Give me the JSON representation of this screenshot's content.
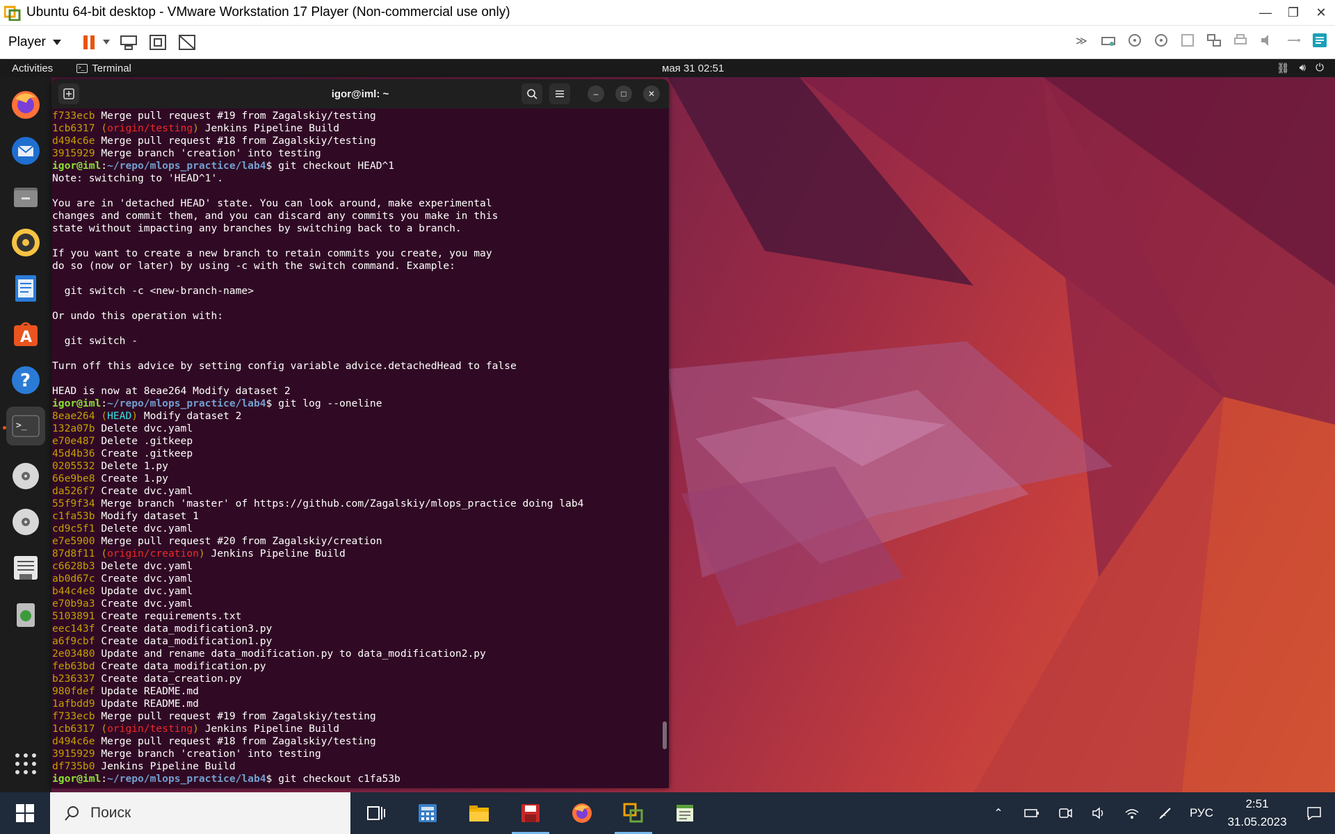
{
  "vmware": {
    "window_title": "Ubuntu 64-bit desktop - VMware Workstation 17 Player (Non-commercial use only)",
    "player_menu": "Player",
    "toolbar_icons": [
      "pause-icon",
      "send-ctrl-alt-del-icon",
      "full-screen-icon",
      "unity-icon"
    ],
    "device_icons": [
      "more-devices-icon",
      "hard-disk-icon",
      "cd-dvd-icon",
      "cd-dvd-icon",
      "floppy-icon",
      "network-adapter-icon",
      "printer-icon",
      "sound-card-icon",
      "usb-icon",
      "message-log-icon"
    ]
  },
  "ubuntu_bar": {
    "activities": "Activities",
    "app_name": "Terminal",
    "clock": "мая 31  02:51"
  },
  "dock": {
    "apps": [
      "firefox",
      "thunderbird",
      "files",
      "rhythmbox",
      "libreoffice-writer",
      "ubuntu-software",
      "help",
      "terminal",
      "dvd-drive",
      "dvd-drive",
      "text-document",
      "trash",
      "show-apps"
    ]
  },
  "terminal": {
    "title": "igor@iml: ~",
    "prompt_user": "igor@iml",
    "prompt_path": "~/repo/mlops_practice/lab4",
    "lines": [
      {
        "t": "log",
        "hash": "f733ecb",
        "msg": "Merge pull request #19 from Zagalskiy/testing"
      },
      {
        "t": "log",
        "hash": "1cb6317",
        "ref": "origin/testing",
        "msg": "Jenkins Pipeline Build"
      },
      {
        "t": "log",
        "hash": "d494c6e",
        "msg": "Merge pull request #18 from Zagalskiy/testing"
      },
      {
        "t": "log",
        "hash": "3915929",
        "msg": "Merge branch 'creation' into testing"
      },
      {
        "t": "prompt",
        "cmd": "git checkout HEAD^1"
      },
      {
        "t": "text",
        "msg": "Note: switching to 'HEAD^1'."
      },
      {
        "t": "text",
        "msg": ""
      },
      {
        "t": "text",
        "msg": "You are in 'detached HEAD' state. You can look around, make experimental"
      },
      {
        "t": "text",
        "msg": "changes and commit them, and you can discard any commits you make in this"
      },
      {
        "t": "text",
        "msg": "state without impacting any branches by switching back to a branch."
      },
      {
        "t": "text",
        "msg": ""
      },
      {
        "t": "text",
        "msg": "If you want to create a new branch to retain commits you create, you may"
      },
      {
        "t": "text",
        "msg": "do so (now or later) by using -c with the switch command. Example:"
      },
      {
        "t": "text",
        "msg": ""
      },
      {
        "t": "text",
        "msg": "  git switch -c <new-branch-name>"
      },
      {
        "t": "text",
        "msg": ""
      },
      {
        "t": "text",
        "msg": "Or undo this operation with:"
      },
      {
        "t": "text",
        "msg": ""
      },
      {
        "t": "text",
        "msg": "  git switch -"
      },
      {
        "t": "text",
        "msg": ""
      },
      {
        "t": "text",
        "msg": "Turn off this advice by setting config variable advice.detachedHead to false"
      },
      {
        "t": "text",
        "msg": ""
      },
      {
        "t": "text",
        "msg": "HEAD is now at 8eae264 Modify dataset 2"
      },
      {
        "t": "prompt",
        "cmd": "git log --oneline"
      },
      {
        "t": "log",
        "hash": "8eae264",
        "ref": "HEAD",
        "refType": "head",
        "msg": "Modify dataset 2"
      },
      {
        "t": "log",
        "hash": "132a07b",
        "msg": "Delete dvc.yaml"
      },
      {
        "t": "log",
        "hash": "e70e487",
        "msg": "Delete .gitkeep"
      },
      {
        "t": "log",
        "hash": "45d4b36",
        "msg": "Create .gitkeep"
      },
      {
        "t": "log",
        "hash": "0205532",
        "msg": "Delete 1.py"
      },
      {
        "t": "log",
        "hash": "66e9be8",
        "msg": "Create 1.py"
      },
      {
        "t": "log",
        "hash": "da526f7",
        "msg": "Create dvc.yaml"
      },
      {
        "t": "log",
        "hash": "55f9f34",
        "msg": "Merge branch 'master' of https://github.com/Zagalskiy/mlops_practice doing lab4"
      },
      {
        "t": "log",
        "hash": "c1fa53b",
        "msg": "Modify dataset 1"
      },
      {
        "t": "log",
        "hash": "cd9c5f1",
        "msg": "Delete dvc.yaml"
      },
      {
        "t": "log",
        "hash": "e7e5900",
        "msg": "Merge pull request #20 from Zagalskiy/creation"
      },
      {
        "t": "log",
        "hash": "87d8f11",
        "ref": "origin/creation",
        "msg": "Jenkins Pipeline Build"
      },
      {
        "t": "log",
        "hash": "c6628b3",
        "msg": "Delete dvc.yaml"
      },
      {
        "t": "log",
        "hash": "ab0d67c",
        "msg": "Create dvc.yaml"
      },
      {
        "t": "log",
        "hash": "b44c4e8",
        "msg": "Update dvc.yaml"
      },
      {
        "t": "log",
        "hash": "e70b9a3",
        "msg": "Create dvc.yaml"
      },
      {
        "t": "log",
        "hash": "5103891",
        "msg": "Create requirements.txt"
      },
      {
        "t": "log",
        "hash": "eec143f",
        "msg": "Create data_modification3.py"
      },
      {
        "t": "log",
        "hash": "a6f9cbf",
        "msg": "Create data_modification1.py"
      },
      {
        "t": "log",
        "hash": "2e03480",
        "msg": "Update and rename data_modification.py to data_modification2.py"
      },
      {
        "t": "log",
        "hash": "feb63bd",
        "msg": "Create data_modification.py"
      },
      {
        "t": "log",
        "hash": "b236337",
        "msg": "Create data_creation.py"
      },
      {
        "t": "log",
        "hash": "980fdef",
        "msg": "Update README.md"
      },
      {
        "t": "log",
        "hash": "1afbdd9",
        "msg": "Update README.md"
      },
      {
        "t": "log",
        "hash": "f733ecb",
        "msg": "Merge pull request #19 from Zagalskiy/testing"
      },
      {
        "t": "log",
        "hash": "1cb6317",
        "ref": "origin/testing",
        "msg": "Jenkins Pipeline Build"
      },
      {
        "t": "log",
        "hash": "d494c6e",
        "msg": "Merge pull request #18 from Zagalskiy/testing"
      },
      {
        "t": "log",
        "hash": "3915929",
        "msg": "Merge branch 'creation' into testing"
      },
      {
        "t": "log",
        "hash": "df735b0",
        "msg": "Jenkins Pipeline Build"
      },
      {
        "t": "prompt",
        "cmd": "git checkout c1fa53b"
      }
    ]
  },
  "taskbar": {
    "search_placeholder": "Поиск",
    "apps": [
      "task-view-icon",
      "calculator-icon",
      "file-explorer-icon",
      "save-app-icon",
      "firefox-icon",
      "vmware-icon",
      "notepad-icon"
    ],
    "language": "РУС",
    "time": "2:51",
    "date": "31.05.2023"
  }
}
